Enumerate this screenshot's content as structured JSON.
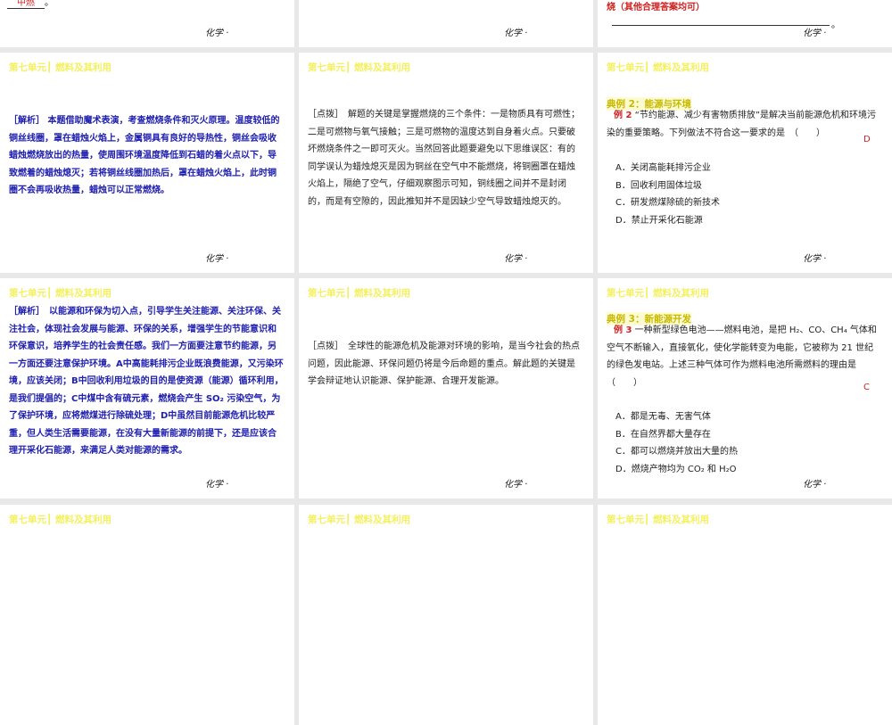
{
  "footer": "化学 ·",
  "unit_header": "第七单元┃ 燃料及其利用",
  "top_row": {
    "left_answer": "中燃",
    "left_end": "。",
    "right_answer": "烧（其他合理答案均可）",
    "right_end": "。"
  },
  "slides": {
    "analysis1": "［解析］ 本题借助魔术表演，考查燃烧条件和灭火原理。温度较低的铜丝线圈，罩在蜡烛火焰上，金属铜具有良好的导热性，铜丝会吸收蜡烛燃烧放出的热量，使周围环境温度降低到石蜡的着火点以下，导致燃着的蜡烛熄灭；若将铜丝线圈加热后，罩在蜡烛火焰上，此时铜圈不会再吸收热量，蜡烛可以正常燃烧。",
    "tip1": "［点拨］　解题的关键是掌握燃烧的三个条件：一是物质具有可燃性；二是可燃物与氧气接触；三是可燃物的温度达到自身着火点。只要破坏燃烧条件之一即可灭火。当然回答此题要避免以下思维误区：有的同学误认为蜡烛熄灭是因为铜丝在空气中不能燃烧，将铜圈罩在蜡烛火焰上，隔绝了空气，仔细观察图示可知，铜线圈之间并不是封闭的，而是有空隙的，因此推知并不是因缺少空气导致蜡烛熄灭的。",
    "example2": {
      "title": "典例 2：能源与环境",
      "label": "例 2",
      "question": "“节约能源、减少有害物质排放”是解决当前能源危机和环境污染的重要策略。下列做法不符合这一要求的是　（　　）",
      "answer": "D",
      "options": [
        "A．关闭高能耗排污企业",
        "B．回收利用固体垃圾",
        "C．研发燃煤除硫的新技术",
        "D．禁止开采化石能源"
      ]
    },
    "analysis2": "［解析］　以能源和环保为切入点，引导学生关注能源、关注环保、关注社会，体现社会发展与能源、环保的关系，增强学生的节能意识和环保意识，培养学生的社会责任感。我们一方面要注意节约能源，另一方面还要注意保护环境。A中高能耗排污企业既浪费能源，又污染环境，应该关闭；B中回收利用垃圾的目的是使资源（能源）循环利用，是我们提倡的；C中煤中含有硫元素，燃烧会产生 SO₂ 污染空气，为了保护环境，应将燃煤进行除硫处理；D中虽然目前能源危机比较严重，但人类生活需要能源，在没有大量新能源的前提下，还是应该合理开采化石能源，来满足人类对能源的需求。",
    "tip2": "［点拨］　全球性的能源危机及能源对环境的影响，是当今社会的热点问题，因此能源、环保问题仍将是今后命题的重点。解此题的关键是学会辩证地认识能源、保护能源、合理开发能源。",
    "example3": {
      "title": "典例 3：新能源开发",
      "label": "例 3",
      "question": "一种新型绿色电池——燃料电池，是把 H₂、CO、CH₄ 气体和空气不断输入，直接氧化，使化学能转变为电能，它被称为 21 世纪的绿色发电站。上述三种气体可作为燃料电池所需燃料的理由是　（　　）",
      "answer": "C",
      "options": [
        "A．都是无毒、无害气体",
        "B．在自然界都大量存在",
        "C．都可以燃烧并放出大量的热",
        "D．燃烧产物均为 CO₂ 和 H₂O"
      ]
    }
  }
}
